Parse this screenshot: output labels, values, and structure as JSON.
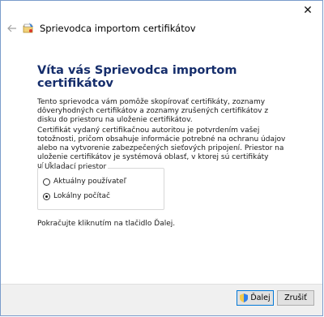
{
  "window": {
    "close_glyph": "✕"
  },
  "header": {
    "title": "Sprievodca importom certifikátov",
    "back_icon": "back-arrow-icon",
    "wizard_icon": "certificate-wizard-icon"
  },
  "main": {
    "heading": "Víta vás Sprievodca importom certifikátov",
    "paragraph1": "Tento sprievodca vám pomôže skopírovať certifikáty, zoznamy dôveryhodných certifikátov a zoznamy zrušených certifikátov z disku do priestoru na uloženie certifikátov.",
    "paragraph2": "Certifikát vydaný certifikačnou autoritou je potvrdením vašej totožnosti, pričom obsahuje informácie potrebné na ochranu údajov alebo na vytvorenie zabezpečených sieťových pripojení. Priestor na uloženie certifikátov je systémová oblasť, v ktorej sú certifikáty uložené.",
    "storage": {
      "legend": "Ukladací priestor",
      "options": [
        {
          "label": "Aktuálny používateľ",
          "checked": false
        },
        {
          "label": "Lokálny počítač",
          "checked": true
        }
      ]
    },
    "paragraph3": "Pokračujte kliknutím na tlačidlo Ďalej."
  },
  "footer": {
    "next_label": "Ďalej",
    "cancel_label": "Zrušiť",
    "accent": "#0078d7"
  }
}
